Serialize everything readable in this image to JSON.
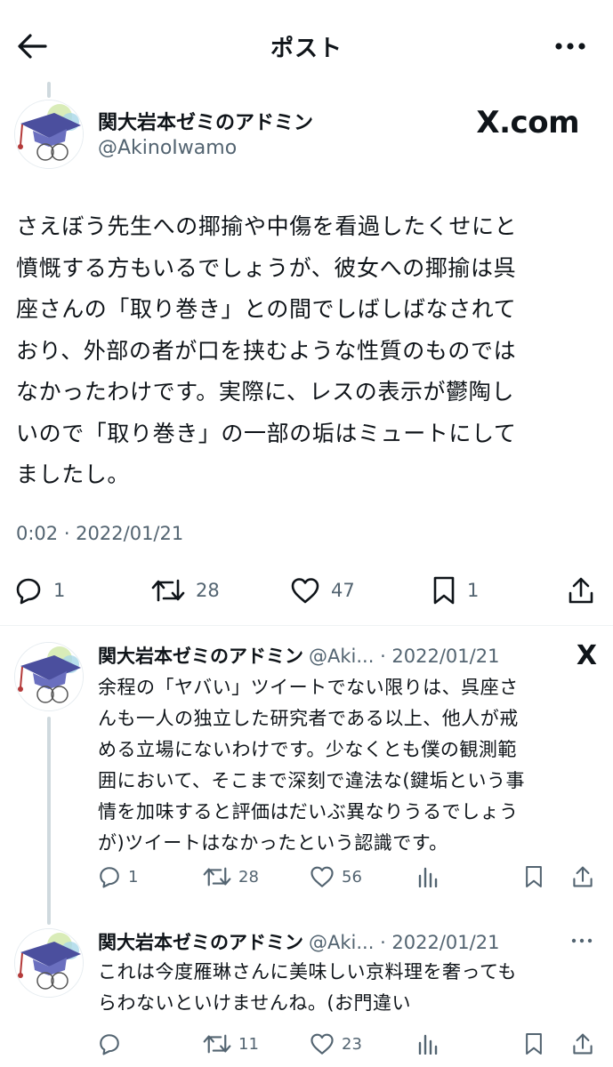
{
  "header": {
    "title": "ポスト",
    "back_icon": "arrow-left-icon",
    "more_icon": "more-horizontal-icon"
  },
  "main_post": {
    "author_name": "関大岩本ゼミのアドミン",
    "handle": "@AkinoIwamo",
    "source_logo": "X.com",
    "lines": [
      "さえぼう先生への揶揄や中傷を看過したくせにと",
      "憤慨する方もいるでしょうが、彼女への揶揄は呉",
      "座さんの「取り巻き」との間でしばしばなされて",
      "おり、外部の者が口を挟むような性質のものでは",
      "なかったわけです。実際に、レスの表示が鬱陶し",
      "いので「取り巻き」の一部の垢はミュートにして",
      "ましたし。"
    ],
    "timestamp": "0:02 · 2022/01/21",
    "replies": "1",
    "retweets": "28",
    "likes": "47",
    "bookmarks": "1"
  },
  "replies": [
    {
      "author_name": "関大岩本ゼミのアドミン",
      "handle_date": "@Aki... · 2022/01/21",
      "badge": "X",
      "lines": [
        "余程の「ヤバい」ツイートでない限りは、呉座さ",
        "んも一人の独立した研究者である以上、他人が戒",
        "める立場にないわけです。少なくとも僕の観測範",
        "囲において、そこまで深刻で違法な(鍵垢という事",
        "情を加味すると評価はだいぶ異なりうるでしょう",
        "が)ツイートはなかったという認識です。"
      ],
      "replies": "1",
      "retweets": "28",
      "likes": "56"
    },
    {
      "author_name": "関大岩本ゼミのアドミン",
      "handle_date": "@Aki... · 2022/01/21",
      "lines": [
        "これは今度雁琳さんに美味しい京料理を奢っても",
        "らわないといけませんね。(お門違い"
      ],
      "replies": "",
      "retweets": "11",
      "likes": "23"
    }
  ],
  "colors": {
    "text": "#0f1419",
    "secondary": "#536471",
    "thread_line": "#cfd9de"
  }
}
